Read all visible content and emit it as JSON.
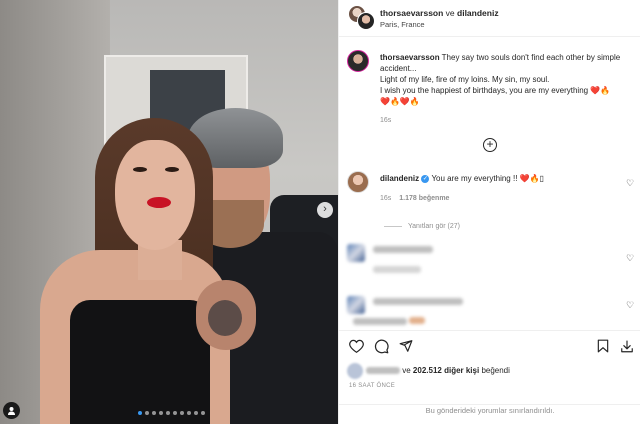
{
  "post": {
    "author1": "thorsaevarsson",
    "conjunction": " ve ",
    "author2": "dilandeniz",
    "location": "Paris, France",
    "carousel": {
      "slide_count": 10,
      "active_index": 0
    }
  },
  "caption": {
    "username": "thorsaevarsson",
    "line1": "They say two souls don't find each other by simple accident...",
    "line2": "Light of my life, fire of my loins. My sin, my soul.",
    "line3": "I wish you the happiest of birthdays, you are my everything ❤️🔥",
    "line4": "❤️🔥❤️🔥",
    "time": "16s"
  },
  "comment": {
    "username": "dilandeniz",
    "text": "You are my everything !! ❤️🔥▯",
    "time": "16s",
    "likes": "1.178 beğenme",
    "replies": "Yanıtları gör (27)"
  },
  "likes": {
    "count": "202.512",
    "text_suffix": "diğer kişi",
    "text_end": "beğendi",
    "prefix": "ve"
  },
  "time_ago": "16 SAAT ÖNCE",
  "comments_limited": "Bu gönderideki yorumlar sınırlandırıldı.",
  "colors": {
    "accent": "#3897f0",
    "border": "#efefef",
    "text": "#262626",
    "muted": "#8e8e8e"
  },
  "icons": [
    "tag-user-icon",
    "next-arrow-icon",
    "add-comment-icon",
    "heart-icon",
    "comment-icon",
    "share-icon",
    "save-icon",
    "download-icon",
    "verified-icon"
  ]
}
